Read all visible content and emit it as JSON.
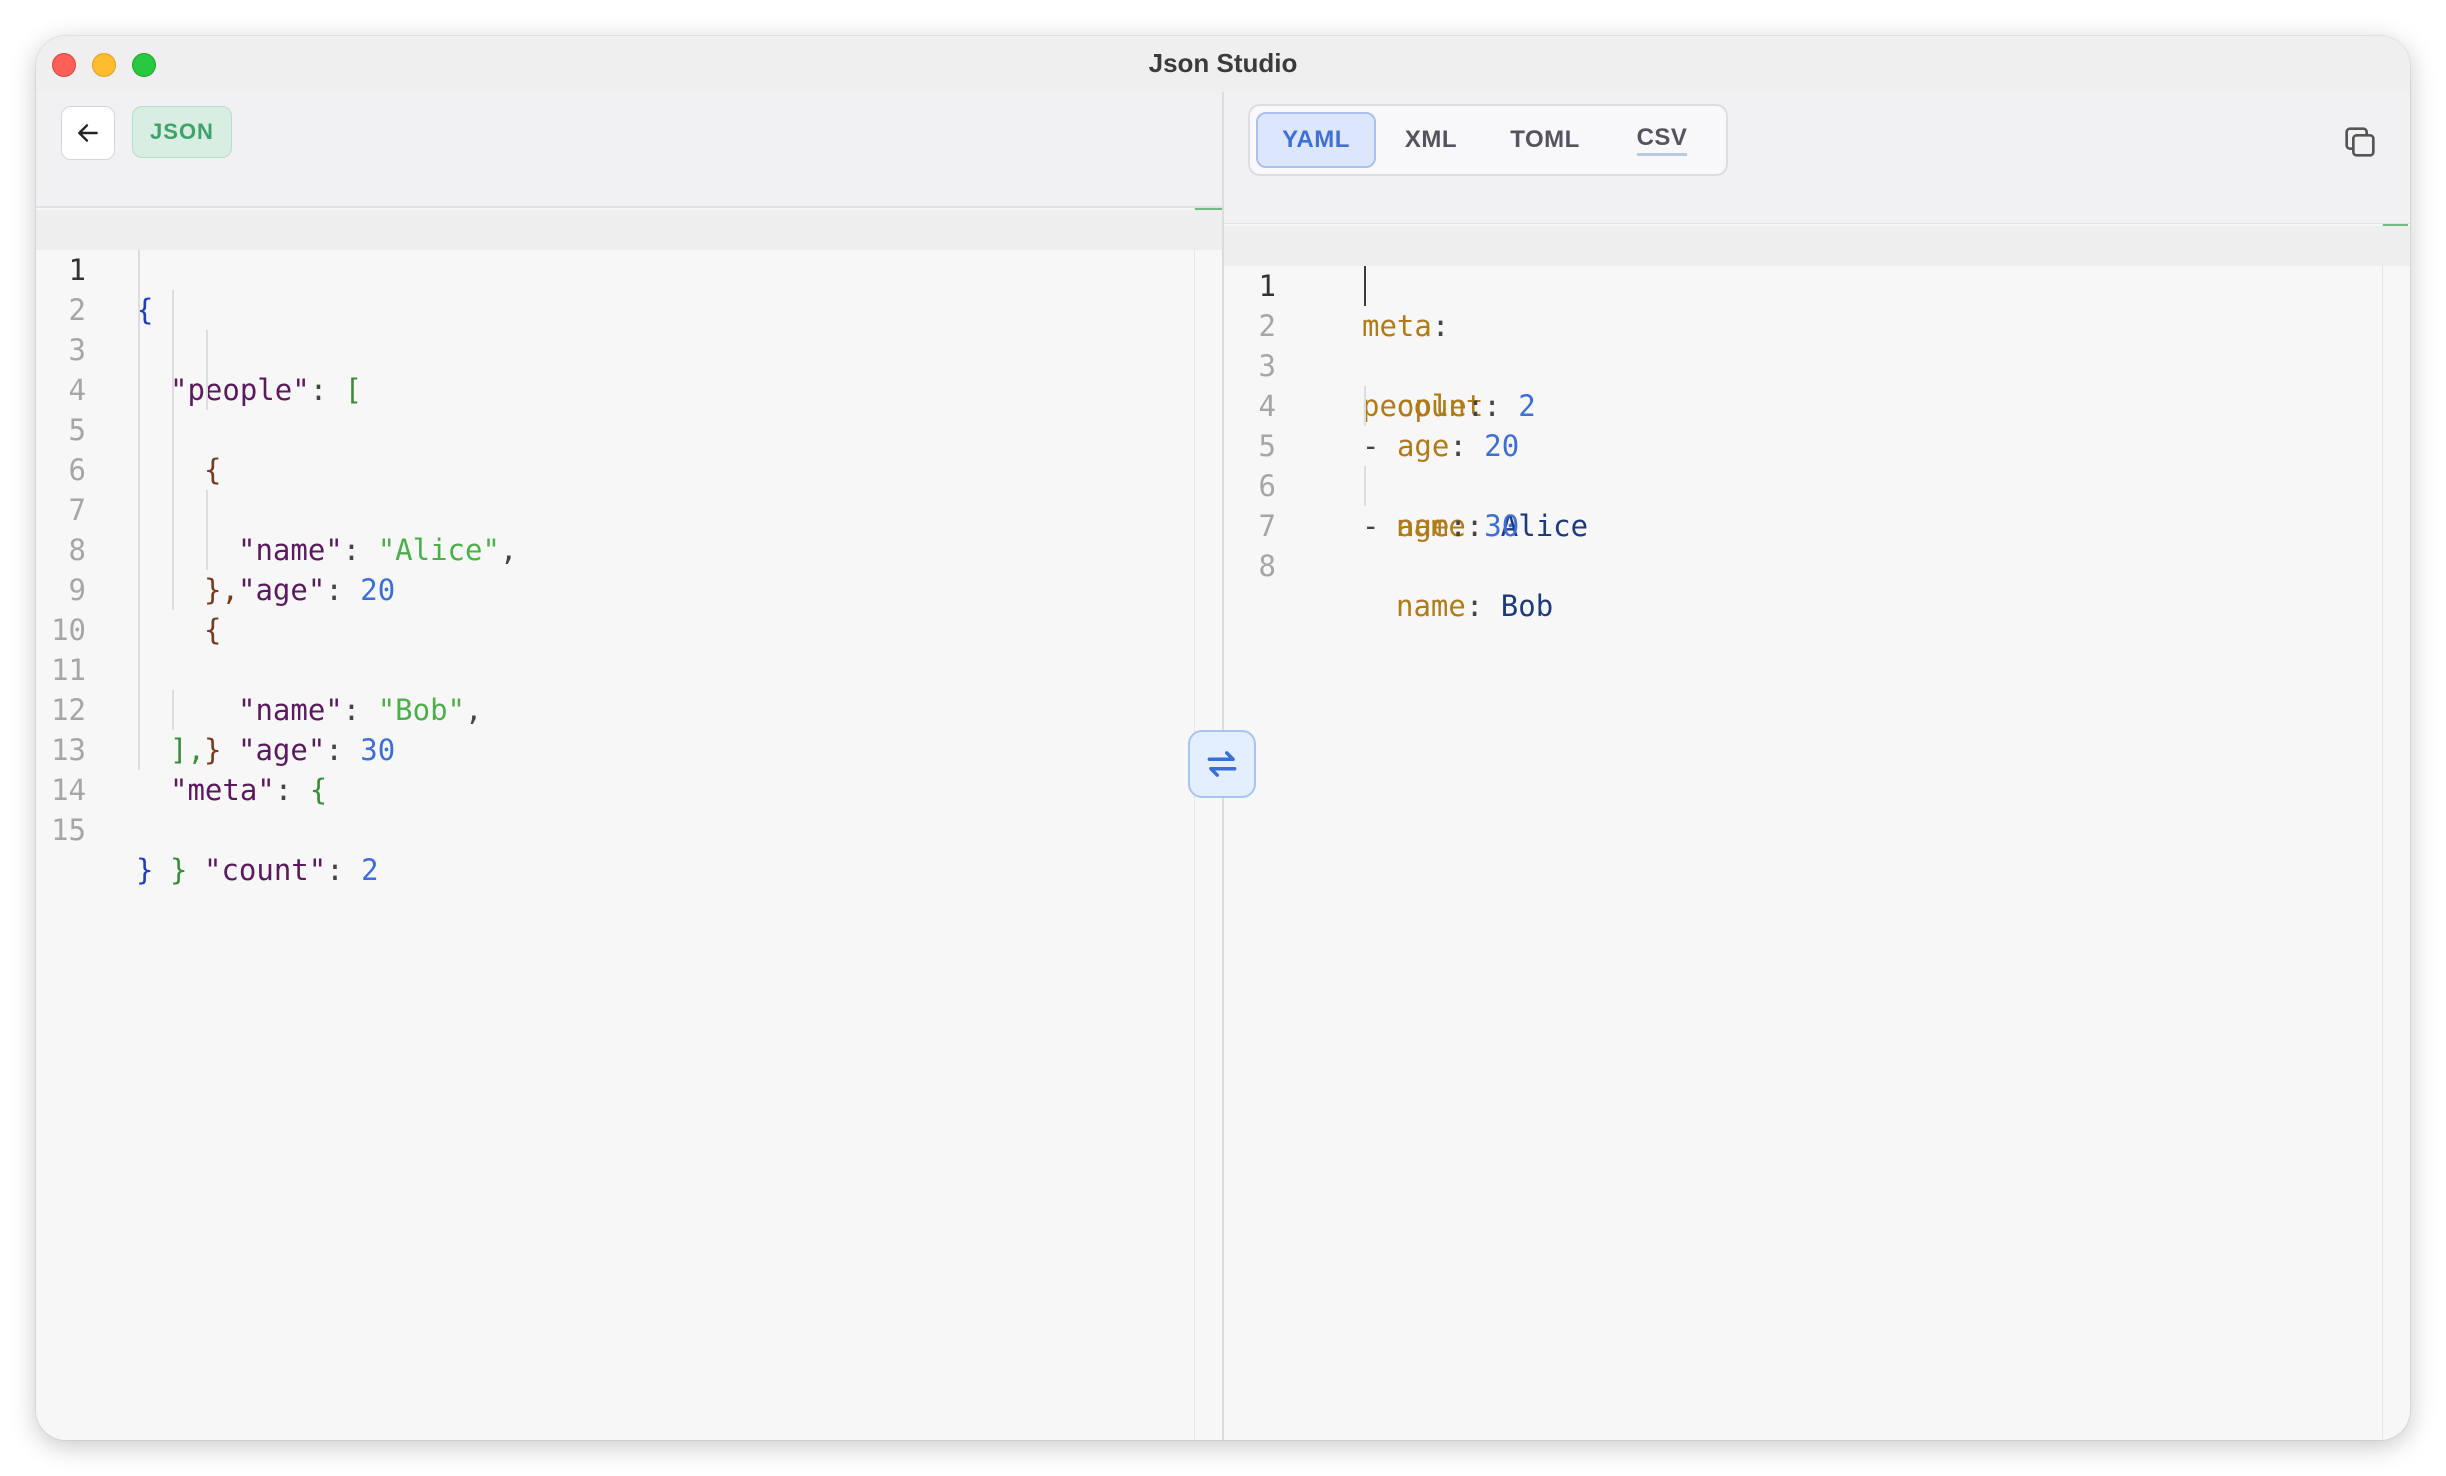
{
  "window": {
    "title": "Json Studio"
  },
  "left": {
    "language_badge": "JSON",
    "lines": [
      {
        "n": "1"
      },
      {
        "n": "2"
      },
      {
        "n": "3"
      },
      {
        "n": "4"
      },
      {
        "n": "5"
      },
      {
        "n": "6"
      },
      {
        "n": "7"
      },
      {
        "n": "8"
      },
      {
        "n": "9"
      },
      {
        "n": "10"
      },
      {
        "n": "11"
      },
      {
        "n": "12"
      },
      {
        "n": "13"
      },
      {
        "n": "14"
      },
      {
        "n": "15"
      }
    ],
    "code": {
      "open_brace": "{",
      "people_key": "\"people\"",
      "colon": ":",
      "open_bracket": "[",
      "obj_open": "{",
      "name_key": "\"name\"",
      "alice": "\"Alice\"",
      "comma": ",",
      "age_key": "\"age\"",
      "age1": "20",
      "obj_close_comma": "},",
      "bob": "\"Bob\"",
      "age2": "30",
      "obj_close": "}",
      "close_bracket_comma": "],",
      "meta_key": "\"meta\"",
      "meta_open": "{",
      "count_key": "\"count\"",
      "count_val": "2",
      "meta_close": "}",
      "close_brace": "}"
    }
  },
  "right": {
    "tabs": [
      {
        "label": "YAML",
        "active": true
      },
      {
        "label": "XML"
      },
      {
        "label": "TOML"
      },
      {
        "label": "CSV"
      }
    ],
    "lines": [
      {
        "n": "1"
      },
      {
        "n": "2"
      },
      {
        "n": "3"
      },
      {
        "n": "4"
      },
      {
        "n": "5"
      },
      {
        "n": "6"
      },
      {
        "n": "7"
      },
      {
        "n": "8"
      }
    ],
    "code": {
      "meta": "meta",
      "colon": ":",
      "count": "count",
      "count_val": "2",
      "people": "people",
      "dash": "-",
      "age": "age",
      "age1": "20",
      "name": "name",
      "alice": "Alice",
      "age2": "30",
      "bob": "Bob"
    }
  },
  "colors": {
    "accent": "#4170d4",
    "json_badge": "#3fa26b",
    "string": "#4daf4a",
    "number": "#3d6fd6",
    "key": "#5b1a5d",
    "yaml_key": "#b07c1a"
  }
}
